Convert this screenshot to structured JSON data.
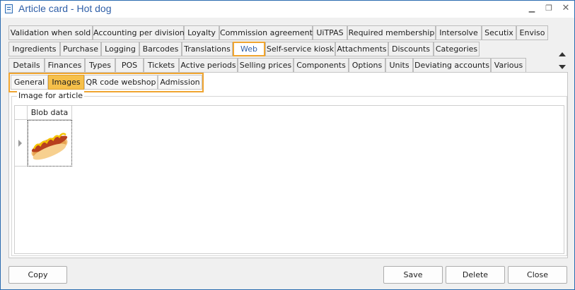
{
  "window": {
    "title": "Article card - Hot dog"
  },
  "tabs": {
    "row1": [
      "Validation when sold",
      "Accounting per division",
      "Loyalty",
      "Commission agreement",
      "UiTPAS",
      "Required membership",
      "Intersolve",
      "Secutix",
      "Enviso"
    ],
    "row2": [
      "Ingredients",
      "Purchase",
      "Logging",
      "Barcodes",
      "Translations",
      "Web",
      "Self-service kiosk",
      "Attachments",
      "Discounts",
      "Categories"
    ],
    "row3": [
      "Details",
      "Finances",
      "Types",
      "POS",
      "Tickets",
      "Active periods",
      "Selling prices",
      "Components",
      "Options",
      "Units",
      "Deviating accounts",
      "Various"
    ],
    "selected": "Web"
  },
  "subtabs": {
    "items": [
      "General",
      "Images",
      "QR code webshop",
      "Admission"
    ],
    "selected": "Images"
  },
  "images": {
    "group_title": "Image for article",
    "column_header": "Blob data",
    "row_image": "hot-dog-image"
  },
  "buttons": {
    "copy": "Copy",
    "save": "Save",
    "delete": "Delete",
    "close": "Close"
  },
  "icons": {
    "app": "document-icon",
    "minimize": "minimize-icon",
    "maximize": "maximize-icon",
    "close": "close-icon",
    "scroll_up": "scroll-up-arrow-icon",
    "scroll_down": "scroll-down-arrow-icon"
  },
  "colors": {
    "accent_highlight": "#f0a530",
    "selected_subtab": "#f6c04a",
    "title_text": "#2f5fa8"
  }
}
